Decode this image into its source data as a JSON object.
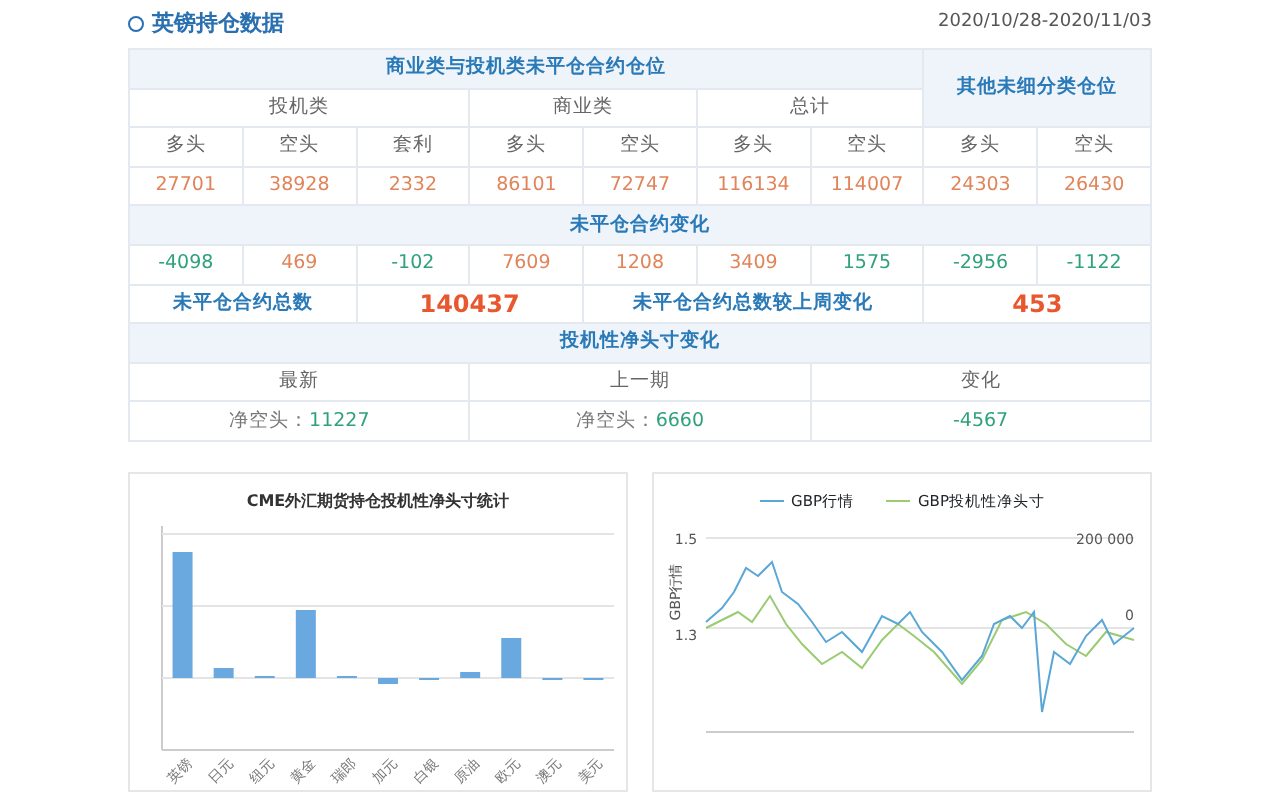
{
  "title": "英镑持仓数据",
  "date_range": "2020/10/28-2020/11/03",
  "table": {
    "group_header": "商业类与投机类未平仓合约仓位",
    "other_header": "其他未细分类仓位",
    "subgroups": [
      "投机类",
      "商业类",
      "总计"
    ],
    "columns": [
      "多头",
      "空头",
      "套利",
      "多头",
      "空头",
      "多头",
      "空头",
      "多头",
      "空头"
    ],
    "positions": [
      {
        "value": "27701",
        "color": "#e0845a"
      },
      {
        "value": "38928",
        "color": "#e0845a"
      },
      {
        "value": "2332",
        "color": "#e0845a"
      },
      {
        "value": "86101",
        "color": "#e0845a"
      },
      {
        "value": "72747",
        "color": "#e0845a"
      },
      {
        "value": "116134",
        "color": "#e0845a"
      },
      {
        "value": "114007",
        "color": "#e0845a"
      },
      {
        "value": "24303",
        "color": "#e0845a"
      },
      {
        "value": "26430",
        "color": "#e0845a"
      }
    ],
    "change_header": "未平仓合约变化",
    "changes": [
      {
        "value": "-4098",
        "color": "#2fa27c"
      },
      {
        "value": "469",
        "color": "#e0845a"
      },
      {
        "value": "-102",
        "color": "#2fa27c"
      },
      {
        "value": "7609",
        "color": "#e0845a"
      },
      {
        "value": "1208",
        "color": "#e0845a"
      },
      {
        "value": "3409",
        "color": "#e0845a"
      },
      {
        "value": "1575",
        "color": "#2fa27c"
      },
      {
        "value": "-2956",
        "color": "#2fa27c"
      },
      {
        "value": "-1122",
        "color": "#2fa27c"
      }
    ],
    "total_label": "未平仓合约总数",
    "total_value": "140437",
    "weekly_change_label": "未平仓合约总数较上周变化",
    "weekly_change_value": "453",
    "net_header": "投机性净头寸变化",
    "net_columns": [
      "最新",
      "上一期",
      "变化"
    ],
    "net_values": [
      {
        "label": "净空头：",
        "value": "11227"
      },
      {
        "label": "净空头：",
        "value": "6660"
      },
      {
        "value": "-4567"
      }
    ]
  },
  "bar_chart": {
    "title": "CME外汇期货持仓投机性净头寸统计",
    "categories": [
      "英镑",
      "日元",
      "纽元",
      "黄金",
      "瑞郎",
      "加元",
      "白银",
      "原油",
      "欧元",
      "澳元",
      "美元"
    ]
  },
  "line_chart": {
    "legend": [
      {
        "name": "GBP行情",
        "color": "#5aa7d6"
      },
      {
        "name": "GBP投机性净头寸",
        "color": "#9acb72"
      }
    ],
    "ylabel": "GBP行情",
    "left_ticks": [
      "1.5",
      "1.3"
    ],
    "right_ticks": [
      "200 000",
      "0"
    ]
  }
}
